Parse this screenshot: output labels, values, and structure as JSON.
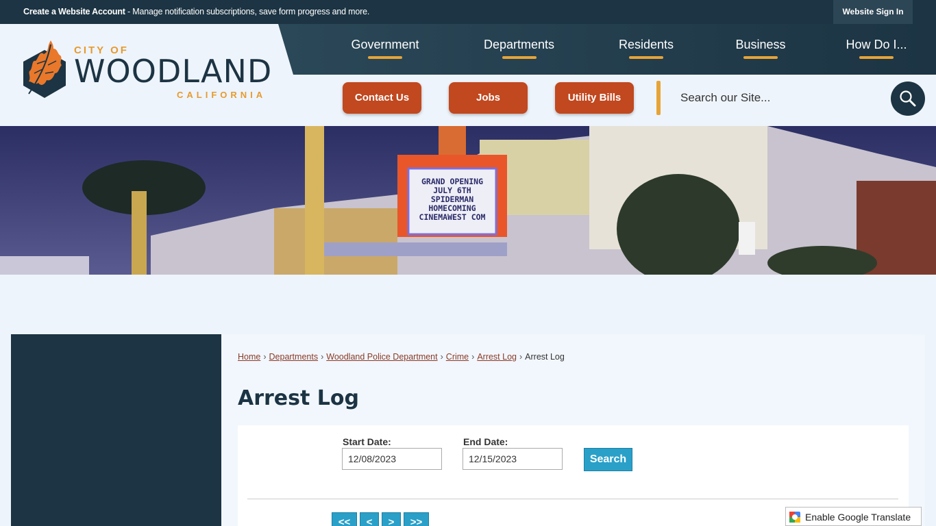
{
  "topbar": {
    "account_link": "Create a Website Account",
    "account_desc": " - Manage notification subscriptions, save form progress and more.",
    "signin_label": "Website Sign In"
  },
  "logo": {
    "city_of": "CITY OF",
    "name": "WOODLAND",
    "state": "CALIFORNIA"
  },
  "nav": {
    "items": [
      "Government",
      "Departments",
      "Residents",
      "Business",
      "How Do I..."
    ]
  },
  "quick_links": [
    "Contact Us",
    "Jobs",
    "Utility Bills"
  ],
  "search": {
    "placeholder": "Search our Site...",
    "icon": "magnifier-icon"
  },
  "banner": {
    "marquee_lines": [
      "GRAND OPENING",
      "JULY 6TH",
      "SPIDERMAN",
      "HOMECOMING",
      "CINEMAWEST COM"
    ]
  },
  "breadcrumb": {
    "items": [
      "Home",
      "Departments",
      "Woodland Police Department",
      "Crime",
      "Arrest Log"
    ],
    "current": "Arrest Log"
  },
  "page": {
    "title": "Arrest Log"
  },
  "form": {
    "start_label": "Start Date:",
    "start_value": "12/08/2023",
    "end_label": "End Date:",
    "end_value": "12/15/2023",
    "search_label": "Search"
  },
  "pager": [
    "<<",
    "<",
    ">",
    ">>"
  ],
  "translate": {
    "label": "Enable Google Translate"
  },
  "colors": {
    "navy": "#1c3443",
    "accent_orange": "#c1481f",
    "accent_gold": "#e6a437",
    "button_blue": "#2aa0c8"
  }
}
